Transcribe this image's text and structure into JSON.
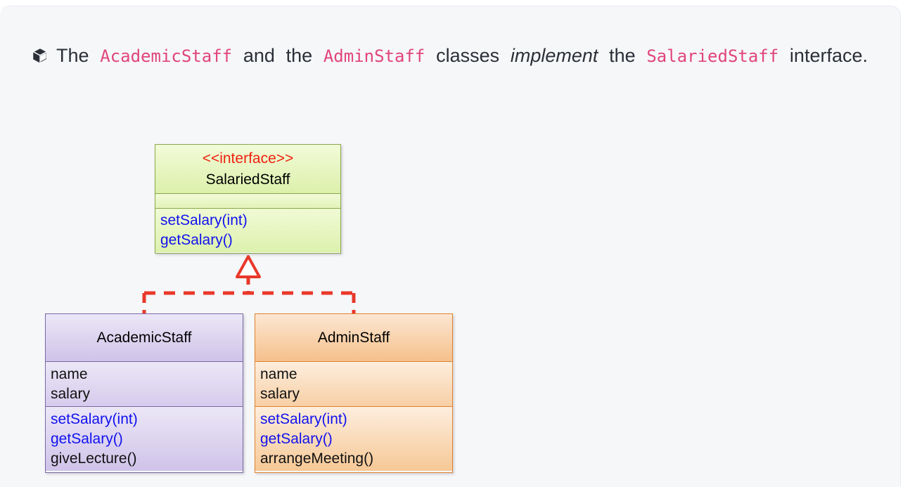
{
  "callout": {
    "icon": "cube-icon",
    "segments": [
      {
        "text": "The ",
        "style": "plain"
      },
      {
        "text": "AcademicStaff",
        "style": "code"
      },
      {
        "text": " and the ",
        "style": "plain"
      },
      {
        "text": "AdminStaff",
        "style": "code"
      },
      {
        "text": " classes ",
        "style": "plain"
      },
      {
        "text": "implement",
        "style": "em"
      },
      {
        "text": " the ",
        "style": "plain"
      },
      {
        "text": "SalariedStaff",
        "style": "code"
      },
      {
        "text": " interface.",
        "style": "plain"
      }
    ],
    "full_text": "The AcademicStaff and the AdminStaff classes implement the SalariedStaff interface."
  },
  "colors": {
    "page_background": "#f6f7f9",
    "code_accent": "#e0457b",
    "text": "#2b2f38",
    "interface_border": "#8aa84a",
    "interface_fill": "#dcf0ab",
    "stereotype": "#ee2211",
    "academic_border": "#7a68a6",
    "academic_fill": "#cfc3e9",
    "admin_border": "#e0822e",
    "admin_fill": "#f5c08b",
    "method_blue": "#1111ee",
    "connector_red": "#e8382a"
  },
  "diagram": {
    "type": "uml-class-diagram",
    "relationship": {
      "kind": "realization",
      "label": "implements",
      "line_style": "dashed",
      "arrowhead": "hollow-triangle",
      "from": [
        "AcademicStaff",
        "AdminStaff"
      ],
      "to": "SalariedStaff"
    },
    "interface": {
      "stereotype": "<<interface>>",
      "name": "SalariedStaff",
      "attributes": [],
      "operations": [
        {
          "text": "setSalary(int)",
          "color": "blue"
        },
        {
          "text": "getSalary()",
          "color": "blue"
        }
      ]
    },
    "classes": [
      {
        "name": "AcademicStaff",
        "attributes": [
          "name",
          "salary"
        ],
        "operations": [
          {
            "text": "setSalary(int)",
            "color": "blue"
          },
          {
            "text": "getSalary()",
            "color": "blue"
          },
          {
            "text": "giveLecture()",
            "color": "black"
          }
        ]
      },
      {
        "name": "AdminStaff",
        "attributes": [
          "name",
          "salary"
        ],
        "operations": [
          {
            "text": "setSalary(int)",
            "color": "blue"
          },
          {
            "text": "getSalary()",
            "color": "blue"
          },
          {
            "text": "arrangeMeeting()",
            "color": "black"
          }
        ]
      }
    ]
  }
}
